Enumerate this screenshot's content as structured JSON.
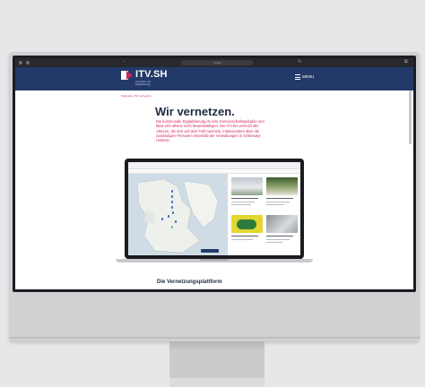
{
  "site": {
    "logo_text": "ITV.SH",
    "logo_sub": "Innovation und Digitalisierung",
    "menu_label": "MENU",
    "url": "itv.sh"
  },
  "page": {
    "breadcrumb": "Startseite / Wir vernetzen",
    "headline": "Wir vernetzen.",
    "intro": "Die kommunale Digitalisierung ist eine Gemeinschaftsaufgabe und lässt sich alleine nicht bewerkstelligen. Die ITV.SH vernetzt alle Akteure, die sich auf dem Feld tummeln, insbesondere aber die zuständigen Personen innerhalb der Verwaltungen in Schleswig-Holstein.",
    "section_title": "Die Vernetzungsplattform"
  },
  "colors": {
    "header": "#233a69",
    "accent": "#d0265f",
    "headline": "#1f2a44",
    "background": "#e6e7e8"
  },
  "icons": [
    "shield-logo-icon",
    "hamburger-menu-icon",
    "lock-icon"
  ]
}
